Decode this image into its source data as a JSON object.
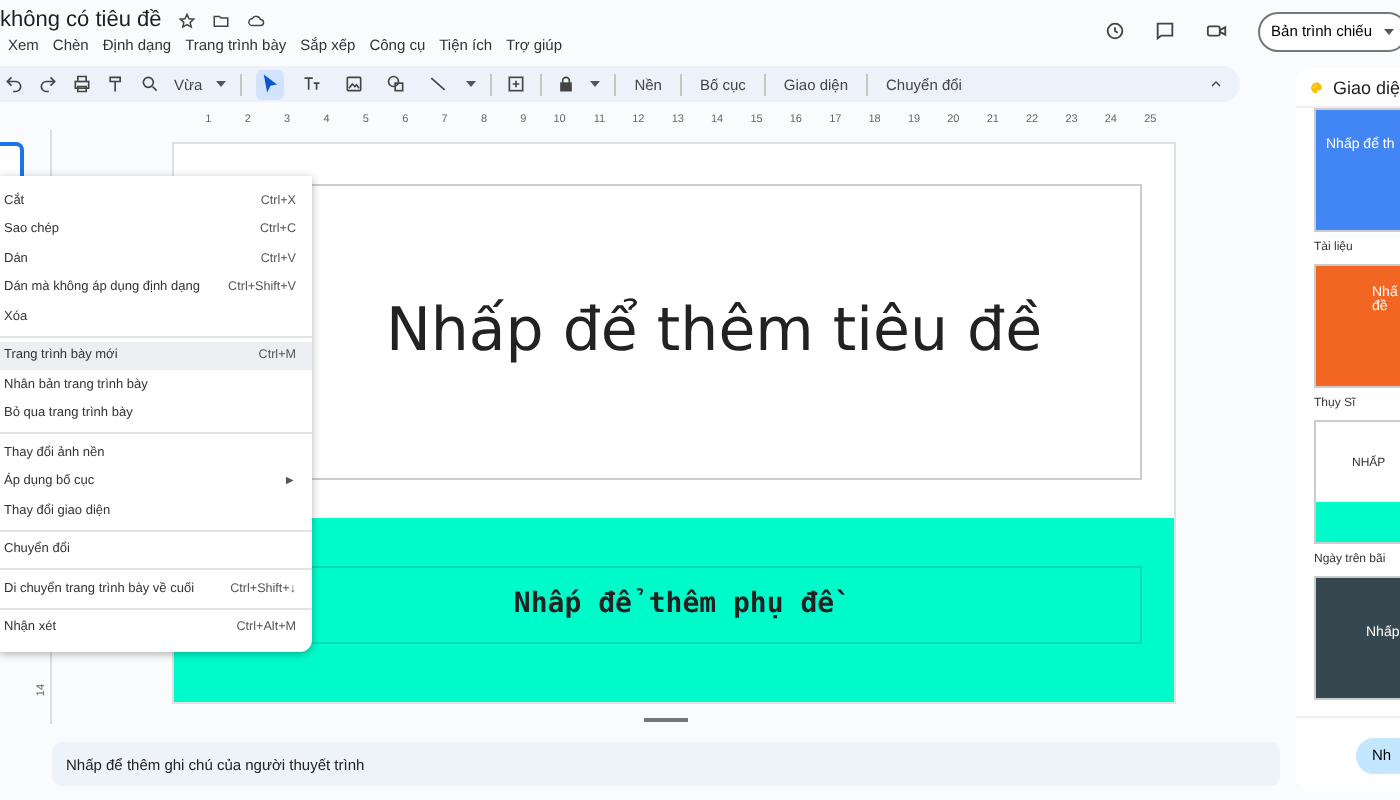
{
  "document": {
    "title": "không có tiêu đề"
  },
  "menubar": [
    "Xem",
    "Chèn",
    "Định dạng",
    "Trang trình bày",
    "Sắp xếp",
    "Công cụ",
    "Tiện ích",
    "Trợ giúp"
  ],
  "present_button": "Bản trình chiếu",
  "toolbar": {
    "zoom": "Vừa",
    "tools": [
      {
        "kind": "select",
        "selected": true
      },
      {
        "kind": "text",
        "selected": false
      },
      {
        "kind": "image",
        "selected": false
      },
      {
        "kind": "shape",
        "selected": false
      },
      {
        "kind": "line",
        "selected": false
      }
    ],
    "buttons": [
      "Nền",
      "Bố cục",
      "Giao diện",
      "Chuyển đổi"
    ]
  },
  "ruler": {
    "marks": [
      "1",
      "2",
      "3",
      "4",
      "5",
      "6",
      "7",
      "8",
      "9",
      "10",
      "11",
      "12",
      "13",
      "14",
      "15",
      "16",
      "17",
      "18",
      "19",
      "20",
      "21",
      "22",
      "23",
      "24",
      "25"
    ],
    "vertical_marks": [
      "14"
    ]
  },
  "slide": {
    "title": "Nhấp để thêm tiêu đề",
    "subtitle": "Nhấp để thêm phụ đề"
  },
  "notes": {
    "placeholder": "Nhấp để thêm ghi chú của người thuyết trình"
  },
  "context_menu": {
    "groups": [
      {
        "items": [
          {
            "label": "Cắt",
            "shortcut": "Ctrl+X",
            "selected": false
          },
          {
            "label": "Sao chép",
            "shortcut": "Ctrl+C",
            "selected": false
          },
          {
            "label": "Dán",
            "shortcut": "Ctrl+V",
            "selected": false
          },
          {
            "label": "Dán mà không áp dụng định dạng",
            "shortcut": "Ctrl+Shift+V",
            "selected": false
          },
          {
            "label": "Xóa",
            "selected": false
          }
        ]
      },
      {
        "items": [
          {
            "label": "Trang trình bày mới",
            "shortcut": "Ctrl+M",
            "selected": true
          },
          {
            "label": "Nhân bản trang trình bày",
            "selected": false
          },
          {
            "label": "Bỏ qua trang trình bày",
            "selected": false
          }
        ]
      },
      {
        "items": [
          {
            "label": "Thay đổi ảnh nền",
            "selected": false
          },
          {
            "label": "Áp dụng bố cục",
            "arrow": "►",
            "selected": false
          },
          {
            "label": "Thay đổi giao diện",
            "selected": false
          }
        ]
      },
      {
        "items": [
          {
            "label": "Chuyển đổi",
            "selected": false
          }
        ]
      },
      {
        "items": [
          {
            "label": "Di chuyển trang trình bày về cuối",
            "shortcut": "Ctrl+Shift+↓",
            "selected": false
          }
        ]
      },
      {
        "items": [
          {
            "label": "Nhận xét",
            "shortcut": "Ctrl+Alt+M",
            "selected": false
          }
        ]
      }
    ]
  },
  "themes_panel": {
    "title": "Giao diệ",
    "themes": [
      {
        "kind": "blue",
        "preview_title": "Nhấp để th",
        "name": "Tài liệu"
      },
      {
        "kind": "orange",
        "preview_title": "Nhấ đề",
        "name": "Thụy Sĩ"
      },
      {
        "kind": "beach",
        "preview_title": "NHẤP",
        "name": "Ngày trên bãi"
      },
      {
        "kind": "dark",
        "preview_title": "Nhấp"
      }
    ],
    "import_button": "Nh"
  }
}
